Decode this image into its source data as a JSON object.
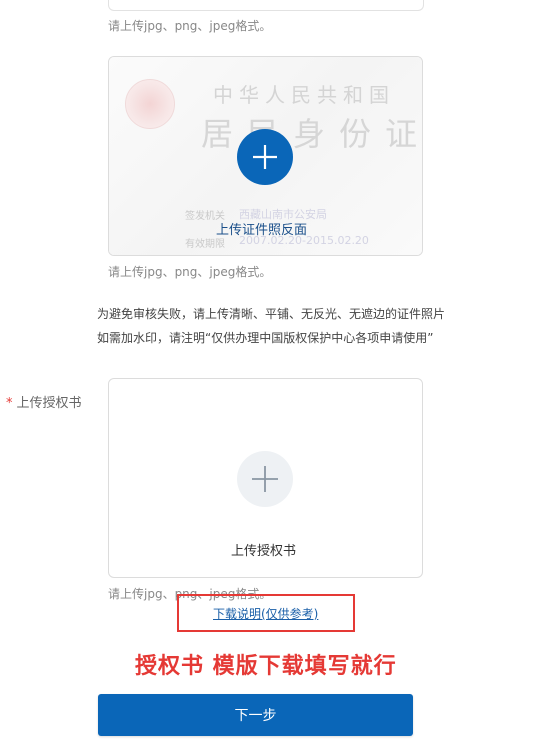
{
  "top_upload": {
    "hint": "请上传jpg、png、jpeg格式。"
  },
  "id_back_upload": {
    "card_title": "中华人民共和国",
    "card_title_large": "居民身份证",
    "issuer_label": "签发机关",
    "issuer_value": "西藏山南市公安局",
    "valid_label": "有效期限",
    "valid_value": "2007.02.20-2015.02.20",
    "label": "上传证件照反面",
    "hint": "请上传jpg、png、jpeg格式。"
  },
  "notice": {
    "line1": "为避免审核失败，请上传清晰、平铺、无反光、无遮边的证件照片",
    "line2": "如需加水印，请注明“仅供办理中国版权保护中心各项申请使用”"
  },
  "authorization": {
    "required_mark": "*",
    "field_label": "上传授权书",
    "upload_label": "上传授权书",
    "hint": "请上传jpg、png、jpeg格式。",
    "download_link": "下载说明(仅供参考)"
  },
  "annotation": {
    "text": "授权书 模版下载填写就行"
  },
  "next_button": {
    "label": "下一步"
  },
  "colors": {
    "primary": "#0a66b8",
    "annotation_red": "#e53935"
  },
  "icons": {
    "upload_back": "plus-icon",
    "upload_authorization": "plus-icon",
    "emblem": "national-emblem-icon"
  }
}
